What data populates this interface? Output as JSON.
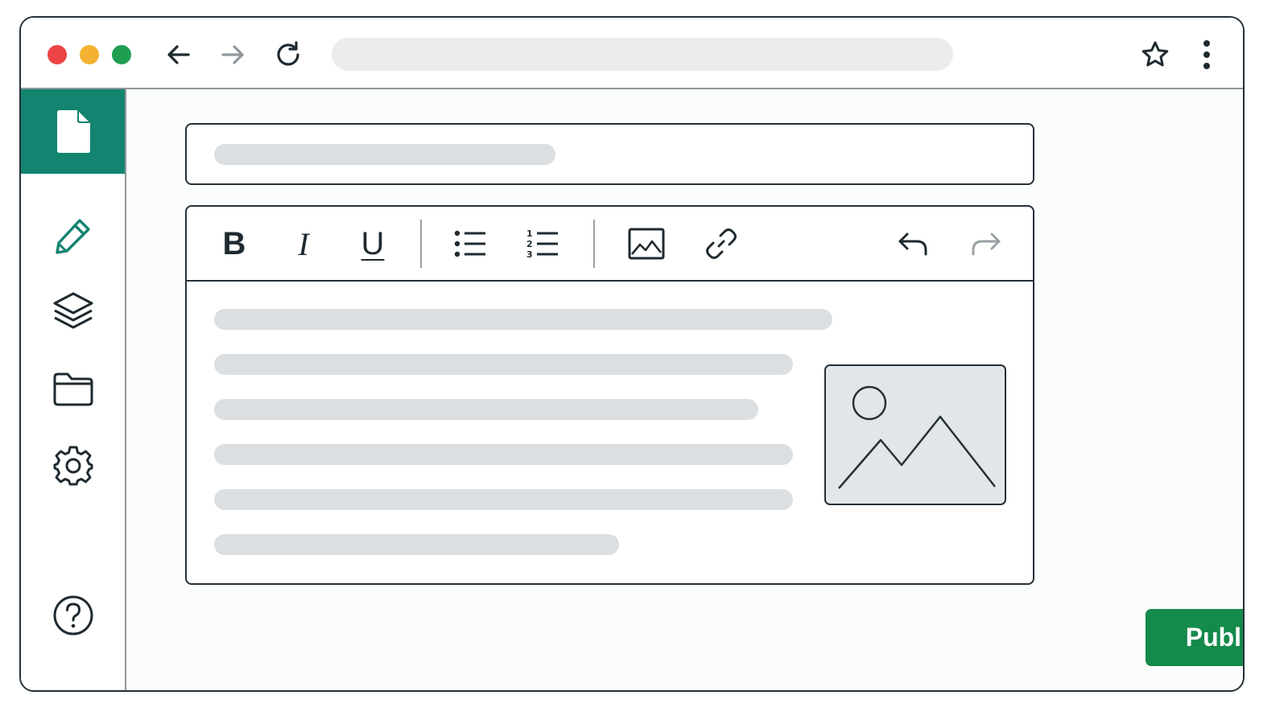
{
  "window": {
    "traffic_lights": {
      "close": "#ec4444",
      "minimize": "#f5b232",
      "maximize": "#1f9e52"
    },
    "nav": [
      "back-icon",
      "forward-icon",
      "reload-icon"
    ],
    "toolbar_right": [
      "star-icon",
      "more-vertical-icon"
    ]
  },
  "sidebar": {
    "accent": "#12846f",
    "items": [
      {
        "icon": "document-icon",
        "active": true
      },
      {
        "icon": "pencil-icon",
        "active": false
      },
      {
        "icon": "layers-icon",
        "active": false
      },
      {
        "icon": "folder-icon",
        "active": false
      },
      {
        "icon": "gear-icon",
        "active": false
      },
      {
        "icon": "help-icon",
        "active": false
      }
    ]
  },
  "editor": {
    "toolbar": {
      "bold_label": "B",
      "italic_label": "I",
      "underline_label": "U",
      "tools": [
        "bold",
        "italic",
        "underline",
        "bulleted-list-icon",
        "numbered-list-icon",
        "image-icon",
        "link-icon",
        "undo-icon",
        "redo-icon"
      ]
    }
  },
  "actions": {
    "publish_label": "Publish",
    "publish_color": "#148a4b"
  }
}
